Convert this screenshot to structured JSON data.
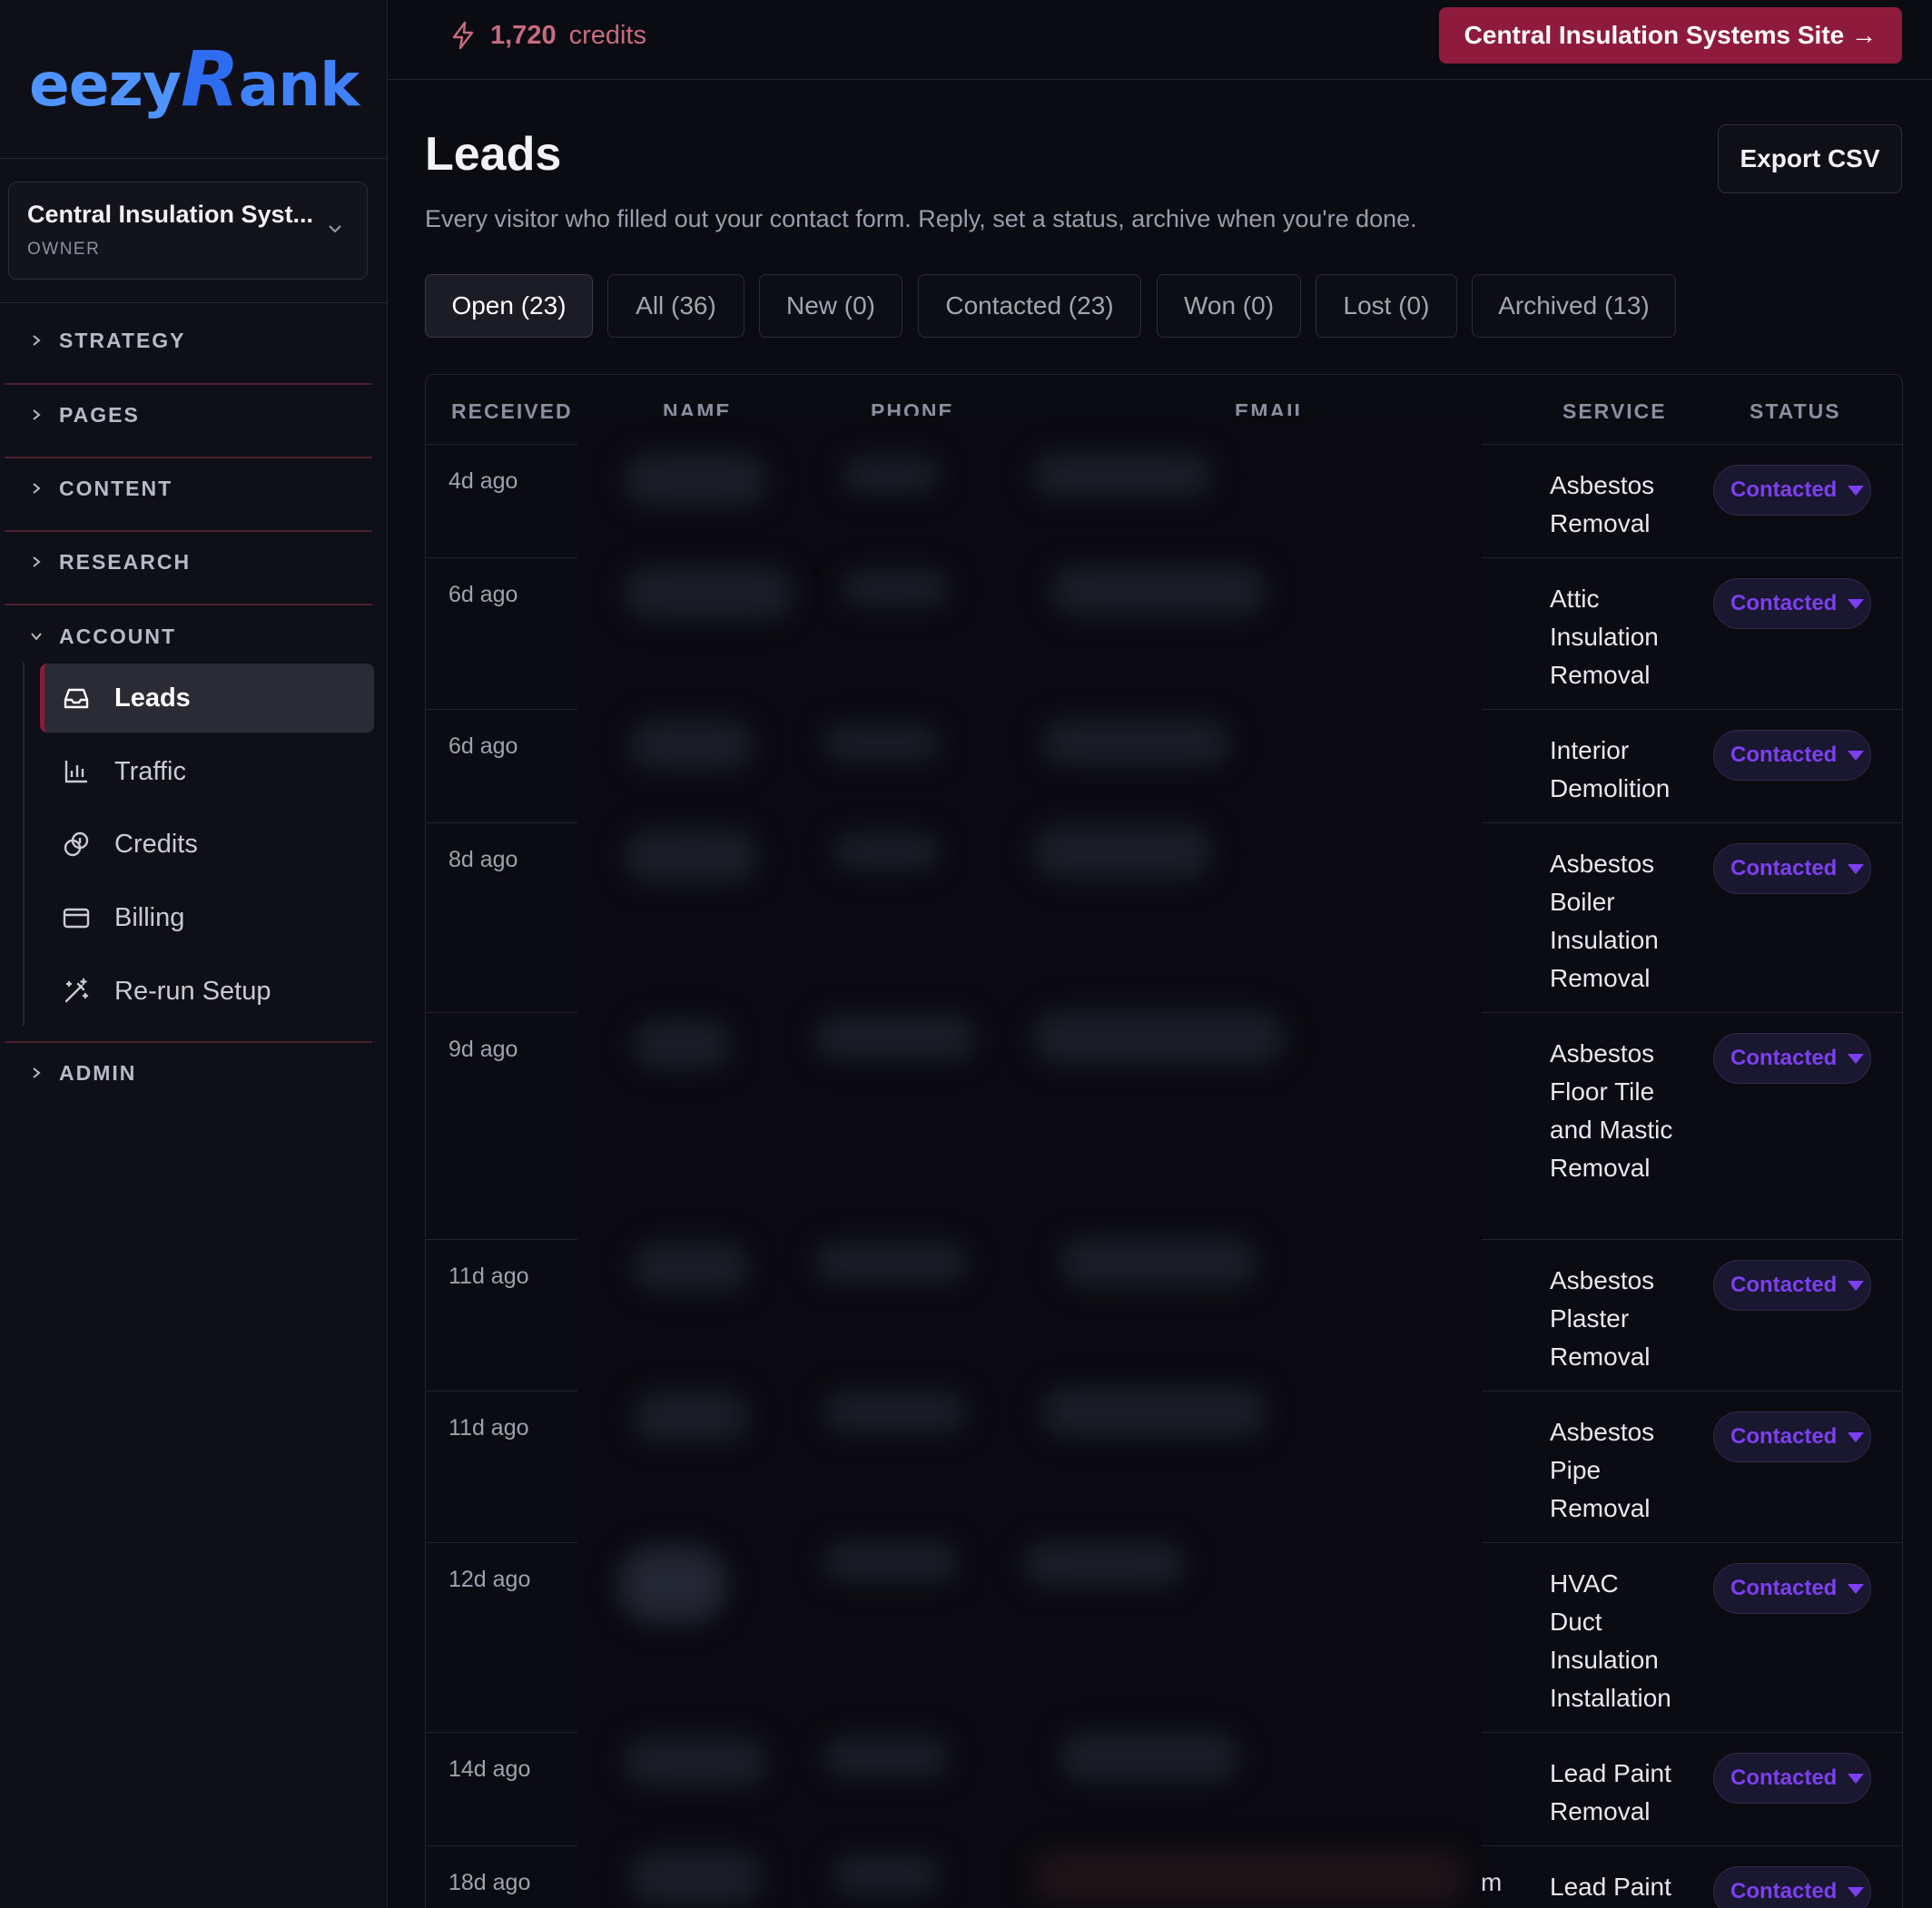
{
  "sidebar": {
    "logo": {
      "part1": "eezy",
      "part2": "R",
      "part3": "ank"
    },
    "workspace": {
      "name": "Central Insulation Syst...",
      "role": "OWNER"
    },
    "sections": [
      "STRATEGY",
      "PAGES",
      "CONTENT",
      "RESEARCH",
      "ACCOUNT",
      "ADMIN"
    ],
    "account_items": [
      {
        "label": "Leads",
        "icon": "inbox-icon"
      },
      {
        "label": "Traffic",
        "icon": "bar-chart-icon"
      },
      {
        "label": "Credits",
        "icon": "coins-icon"
      },
      {
        "label": "Billing",
        "icon": "credit-card-icon"
      },
      {
        "label": "Re-run Setup",
        "icon": "magic-wand-icon"
      }
    ]
  },
  "topbar": {
    "credits_value": "1,720",
    "credits_label": "credits",
    "site_button": "Central Insulation Systems Site →"
  },
  "page": {
    "title": "Leads",
    "subtitle": "Every visitor who filled out your contact form. Reply, set a status, archive when you're done.",
    "export_label": "Export CSV",
    "tabs": [
      "Open (23)",
      "All (36)",
      "New (0)",
      "Contacted (23)",
      "Won (0)",
      "Lost (0)",
      "Archived (13)"
    ]
  },
  "table": {
    "columns": [
      "RECEIVED",
      "NAME",
      "PHONE",
      "EMAIL",
      "SERVICE",
      "STATUS"
    ],
    "rows": [
      {
        "received": "4d ago",
        "service": "Asbestos Removal",
        "status": "Contacted"
      },
      {
        "received": "6d ago",
        "service": "Attic Insulation Removal",
        "status": "Contacted"
      },
      {
        "received": "6d ago",
        "service": "Interior Demolition",
        "status": "Contacted"
      },
      {
        "received": "8d ago",
        "service": "Asbestos Boiler Insulation Removal",
        "status": "Contacted"
      },
      {
        "received": "9d ago",
        "service": "Asbestos Floor Tile and Mastic Removal",
        "status": "Contacted"
      },
      {
        "received": "11d ago",
        "service": "Asbestos Plaster Removal",
        "status": "Contacted"
      },
      {
        "received": "11d ago",
        "service": "Asbestos Pipe Removal",
        "status": "Contacted"
      },
      {
        "received": "12d ago",
        "service": "HVAC Duct Insulation Installation",
        "status": "Contacted"
      },
      {
        "received": "14d ago",
        "service": "Lead Paint Removal",
        "status": "Contacted"
      },
      {
        "received": "18d ago",
        "service": "Lead Paint",
        "status": "Contacted"
      }
    ],
    "email_fragment": "m"
  },
  "colors": {
    "accent": "#8f1b3c",
    "status": "#7d3ff0",
    "logo": "#3f82fb"
  }
}
